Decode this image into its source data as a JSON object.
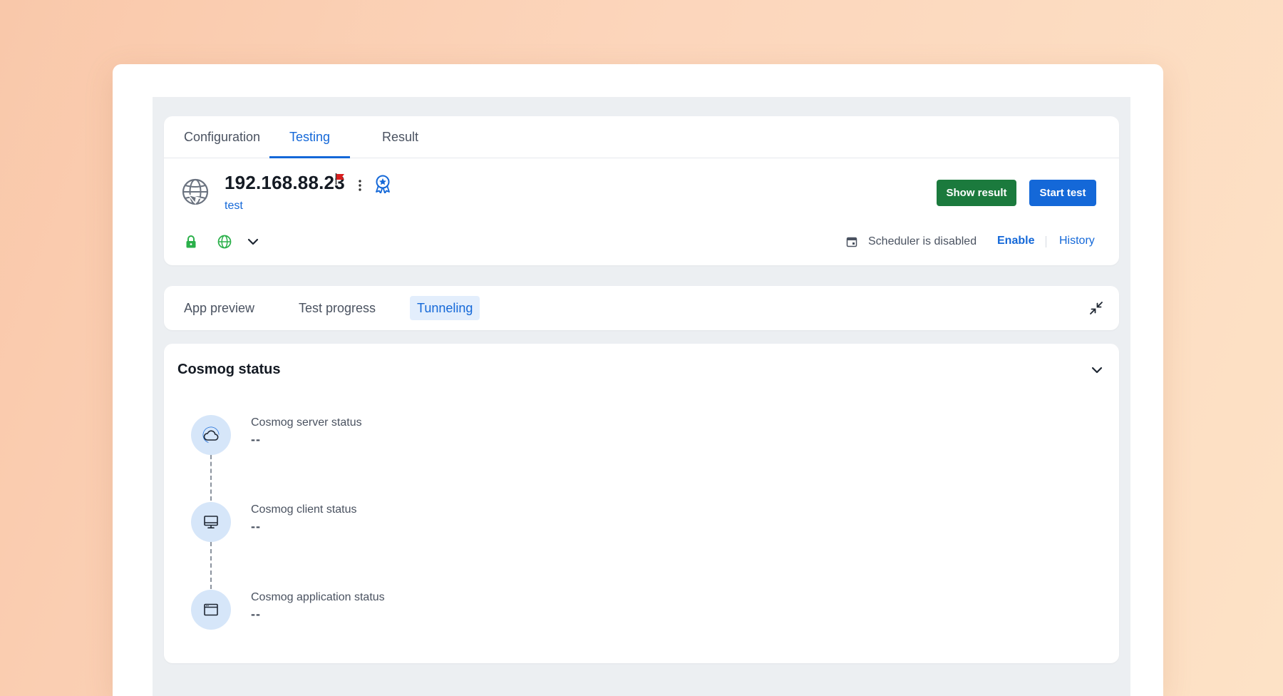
{
  "tabs": [
    {
      "label": "Configuration",
      "active": false
    },
    {
      "label": "Testing",
      "active": true
    },
    {
      "label": "Result",
      "active": false
    }
  ],
  "header": {
    "ip": "192.168.88.23",
    "subtitle": "test",
    "icons": {
      "main": "globe-icon",
      "flag": "flag-icon",
      "menu": "kebab-menu-icon",
      "badge": "award-badge-icon"
    },
    "flag_color": "#d91e1e"
  },
  "buttons": {
    "show_result": "Show result",
    "start_test": "Start test"
  },
  "scheduler": {
    "status_text": "Scheduler is disabled",
    "enable": "Enable",
    "history": "History"
  },
  "sub_tabs": [
    {
      "label": "App preview",
      "active": false
    },
    {
      "label": "Test progress",
      "active": false
    },
    {
      "label": "Tunneling",
      "active": true
    }
  ],
  "status_section": {
    "title": "Cosmog status",
    "steps": [
      {
        "label": "Cosmog server status",
        "value": "--",
        "icon": "cloud-icon"
      },
      {
        "label": "Cosmog client status",
        "value": "--",
        "icon": "monitor-icon"
      },
      {
        "label": "Cosmog application status",
        "value": "--",
        "icon": "app-window-icon"
      }
    ]
  },
  "colors": {
    "primary": "#1468d8",
    "success": "#1b7a3d",
    "lock_green": "#2bb04a",
    "step_bg": "#d6e6f9"
  }
}
